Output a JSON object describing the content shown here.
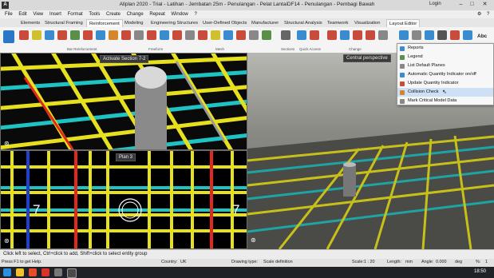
{
  "app": {
    "logo": "A",
    "title": "Allplan 2020 - Trial - Latihan - Jembatan 25m - Penulangan - Pelat LantaiDF14 - Penulangan - Pembagi Bawah",
    "login": "Login"
  },
  "menubar": [
    "File",
    "Edit",
    "View",
    "Insert",
    "Format",
    "Tools",
    "Create",
    "Change",
    "Repeat",
    "Window",
    "?"
  ],
  "tabs": [
    "Elements",
    "Structural Framing",
    "Reinforcement",
    "Modeling",
    "Engineering Structures",
    "User-Defined Objects",
    "Manufacturer",
    "Structural Analysis",
    "Teamwork",
    "Visualization",
    "Layout Editor"
  ],
  "active_tab_index": 2,
  "ribbon_groups": [
    "Bar Reinforcement",
    "Freeform",
    "Mesh",
    "Sections",
    "Quick Access",
    "Change"
  ],
  "viewports": {
    "top_label": "Activate Section 7-2",
    "plan_label": "Plan 3",
    "perspective_label": "Central perspective",
    "grid_numbers": [
      "7",
      "7"
    ]
  },
  "context_menu": {
    "items": [
      "Reports",
      "Legend",
      "List Default Planes",
      "Automatic Quantity Indicator on/off",
      "Update Quantity Indicator",
      "Collision Check",
      "Mark Critical Model Data"
    ],
    "highlighted_index": 5
  },
  "status": {
    "prompt": "Click left to select, Ctrl+click to add, Shift+click to select entity group",
    "help": "Press F1 to get Help.",
    "country_label": "Country:",
    "country": "UK",
    "drawing_type_label": "Drawing type:",
    "drawing_type": "Scale definition",
    "scale_label": "Scale:",
    "scale": "1 : 20",
    "length_label": "Length:",
    "length": "mm",
    "angle_label": "Angle:",
    "angle": "0.000",
    "angle_unit": "deg",
    "percent_label": "%:",
    "percent": "1"
  },
  "taskbar": {
    "time": "18:50"
  },
  "colors": {
    "yellow_bar": "#e6e01e",
    "cyan_bar": "#1fc3c3",
    "red_bar": "#e0291c",
    "menu_highlight": "#cde0f6"
  }
}
